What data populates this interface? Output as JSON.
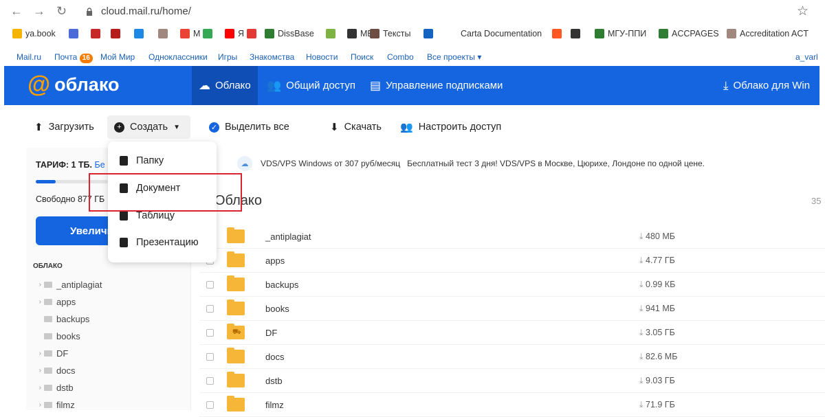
{
  "browser": {
    "url": "cloud.mail.ru/home/",
    "bookmarks": [
      {
        "label": "ya.book",
        "color": "#f4b400"
      },
      {
        "label": "",
        "color": "#4a6bd8"
      },
      {
        "label": "",
        "color": "#c62828"
      },
      {
        "label": "",
        "color": "#b71c1c"
      },
      {
        "label": "",
        "color": "#1e88e5"
      },
      {
        "label": "",
        "color": "#a1887f"
      },
      {
        "label": "M",
        "color": "#ea4335"
      },
      {
        "label": "",
        "color": "#34a853"
      },
      {
        "label": "Я",
        "color": "#ff0000"
      },
      {
        "label": "",
        "color": "#e53935"
      },
      {
        "label": "DissBase",
        "color": "#2e7d32"
      },
      {
        "label": "",
        "color": "#7cb342"
      },
      {
        "label": "МБ",
        "color": "#333333"
      },
      {
        "label": "Тексты",
        "color": "#6d4c41"
      },
      {
        "label": "",
        "color": "#1565c0"
      },
      {
        "label": "Carta Documentation",
        "color": ""
      },
      {
        "label": "",
        "color": "#ff5722"
      },
      {
        "label": "",
        "color": "#333333"
      },
      {
        "label": "МГУ-ППИ",
        "color": "#2e7d32"
      },
      {
        "label": "ACCPAGES",
        "color": "#2e7d32"
      },
      {
        "label": "Accreditation ACT",
        "color": "#a1887f"
      }
    ]
  },
  "portal": {
    "items": [
      "Mail.ru",
      "Почта",
      "Мой Мир",
      "Одноклассники",
      "Игры",
      "Знакомства",
      "Новости",
      "Поиск",
      "Combo",
      "Все проекты ▾"
    ],
    "mail_badge": "16",
    "user": "a_varl"
  },
  "header": {
    "logo_text": "облако",
    "nav": [
      {
        "label": "Облако",
        "icon": "cloud-icon"
      },
      {
        "label": "Общий доступ",
        "icon": "people-icon"
      },
      {
        "label": "Управление подписками",
        "icon": "subscription-icon"
      }
    ],
    "download_app": "Облако для Win"
  },
  "toolbar": {
    "upload": "Загрузить",
    "create": "Создать",
    "select_all": "Выделить все",
    "download": "Скачать",
    "share": "Настроить доступ"
  },
  "create_menu": {
    "items": [
      {
        "label": "Папку",
        "icon": "folder-add-icon"
      },
      {
        "label": "Документ",
        "icon": "document-icon"
      },
      {
        "label": "Таблицу",
        "icon": "table-icon"
      },
      {
        "label": "Презентацию",
        "icon": "presentation-icon"
      }
    ],
    "highlighted": "Документ"
  },
  "sidebar": {
    "tariff_label": "ТАРИФ: 1 ТБ.",
    "tariff_link": "Бе",
    "storage_used_fraction": 0.14,
    "free_text": "Свободно 877 ГБ",
    "upgrade_label": "Увеличи",
    "section_heading": "ОБЛАКО",
    "tree": [
      {
        "label": "_antiplagiat",
        "expandable": true
      },
      {
        "label": "apps",
        "expandable": true
      },
      {
        "label": "backups",
        "expandable": false
      },
      {
        "label": "books",
        "expandable": false
      },
      {
        "label": "DF",
        "expandable": true
      },
      {
        "label": "docs",
        "expandable": true
      },
      {
        "label": "dstb",
        "expandable": true
      },
      {
        "label": "filmz",
        "expandable": true
      }
    ]
  },
  "main": {
    "ad_text": "VDS/VPS Windows от 307 руб/месяц   Бесплатный тест 3 дня! VDS/VPS в Москве, Цюрихе, Лондоне по одной цене.",
    "title": "Облако",
    "count_stub": "35",
    "files": [
      {
        "name": "_antiplagiat",
        "size": "480 МБ"
      },
      {
        "name": "apps",
        "size": "4.77 ГБ"
      },
      {
        "name": "backups",
        "size": "0.99 КБ"
      },
      {
        "name": "books",
        "size": "941 МБ"
      },
      {
        "name": "DF",
        "size": "3.05 ГБ",
        "shared": true
      },
      {
        "name": "docs",
        "size": "82.6 МБ"
      },
      {
        "name": "dstb",
        "size": "9.03 ГБ"
      },
      {
        "name": "filmz",
        "size": "71.9 ГБ"
      }
    ]
  },
  "colors": {
    "brand_blue": "#1565e0",
    "logo_orange": "#ff9e00",
    "folder_yellow": "#f6b638",
    "highlight_red": "#d9232e"
  }
}
